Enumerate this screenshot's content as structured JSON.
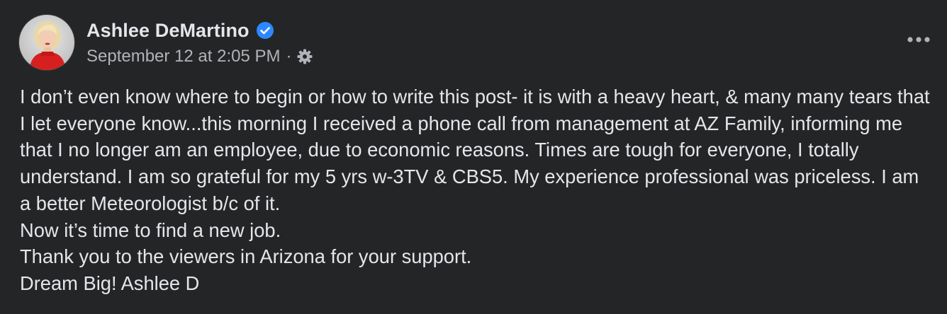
{
  "author": {
    "name": "Ashlee DeMartino",
    "verified": true,
    "avatar_icon": "profile-photo-icon"
  },
  "post_meta": {
    "timestamp": "September 12 at 2:05 PM",
    "separator": "·",
    "audience_icon": "gear-icon"
  },
  "menu": {
    "icon": "more-options-icon"
  },
  "post_text": {
    "paragraph_1": "I don’t even know where to begin or how to write this post- it is with a heavy heart, & many many tears that I let everyone know...this morning I received a phone call from management at AZ Family, informing me that I no longer am an employee, due to economic reasons. Times are tough for everyone, I totally understand. I am so grateful for my 5 yrs w-3TV & CBS5. My experience professional was priceless. I am a better Meteorologist b/c of it.",
    "line_2": "Now it’s time to find a new job.",
    "line_3": "Thank you to the viewers in Arizona for your support.",
    "line_4": "Dream Big! Ashlee D"
  },
  "colors": {
    "background": "#242526",
    "primary_text": "#e4e6eb",
    "secondary_text": "#b0b3b8",
    "verified_blue": "#2d88ff"
  }
}
